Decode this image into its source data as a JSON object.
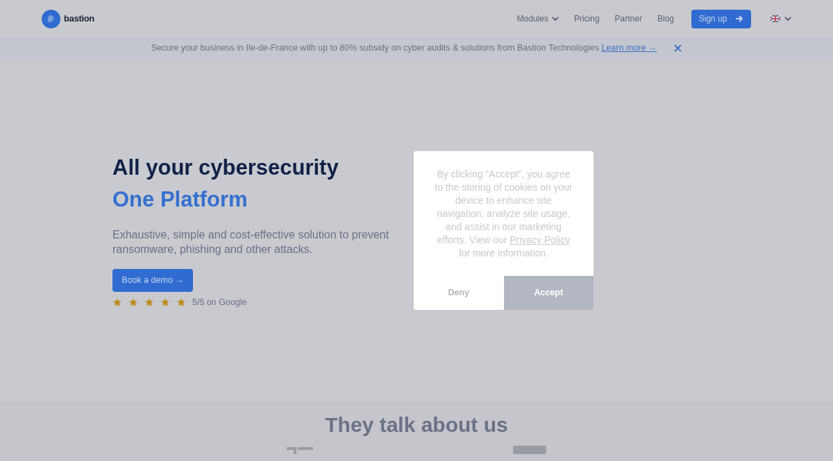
{
  "brand": {
    "name": "bastion"
  },
  "nav": {
    "items": [
      {
        "label": "Modules",
        "kind": "dropdown"
      },
      {
        "label": "Pricing",
        "kind": "link"
      },
      {
        "label": "Partner",
        "kind": "link"
      },
      {
        "label": "Blog",
        "kind": "link"
      }
    ],
    "signup": "Sign up"
  },
  "banner": {
    "text": "Secure your business in Ile-de-France with up to 80% subsidy on cyber audits & solutions from Bastion Technologies",
    "link": "Learn more →"
  },
  "hero": {
    "title": "All your cybersecurity",
    "subtitle": "One Platform",
    "description": "Exhaustive, simple and cost-effective solution to prevent ransomware, phishing and other attacks.",
    "cta": "Book a demo →",
    "stars": 5,
    "rating": "5/5 on Google"
  },
  "cookie_dialog": {
    "text_before": "By clicking “Accept”, you agree to the storing of cookies on your device to enhance site navigation, analyze site usage, and assist in our marketing efforts. View our",
    "link": "Privacy Policy",
    "text_after": "for more information.",
    "deny": "Deny",
    "accept": "Accept"
  },
  "press": {
    "title": "They talk about us"
  }
}
